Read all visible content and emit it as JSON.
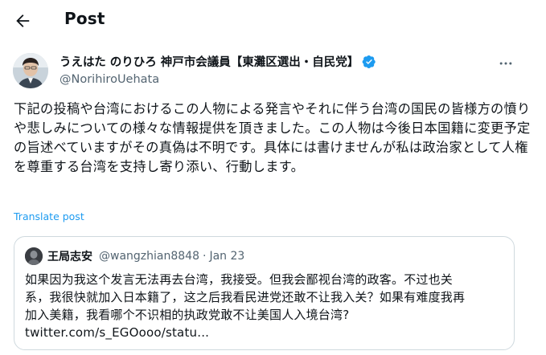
{
  "header": {
    "title": "Post"
  },
  "author": {
    "name": "うえはた のりひろ 神戸市会議員【東灘区選出・自民党】",
    "handle": "@NorihiroUehata",
    "verified": true
  },
  "tweet": {
    "text": "下記の投稿や台湾におけるこの人物による発言やそれに伴う台湾の国民の皆様方の憤りや悲しみについての様々な情報提供を頂きました。この人物は今後日本国籍に変更予定の旨述べていますがその真偽は不明です。具体には書けませんが私は政治家として人権を尊重する台湾を支持し寄り添い、行動します。",
    "translate_label": "Translate post"
  },
  "quote": {
    "name": "王局志安",
    "handle": "@wangzhian8848",
    "separator": "·",
    "date": "Jan 23",
    "text_lines": [
      "如果因为我这个发言无法再去台湾，我接受。但我会鄙视台湾的政客。不过也关",
      "系，我很快就加入日本籍了，这之后我看民进党还敢不让我入关？如果有难度我再",
      "加入美籍，我看哪个不识相的执政党敢不让美国人入境台湾?",
      "twitter.com/s_EGOooo/statu..."
    ]
  },
  "icons": {
    "back": "back-arrow-icon",
    "more": "more-horizontal-icon",
    "verified": "verified-badge-icon"
  },
  "colors": {
    "accent": "#1d9bf0",
    "text_primary": "#0f1419",
    "text_secondary": "#536471",
    "border": "#cfd9de"
  }
}
